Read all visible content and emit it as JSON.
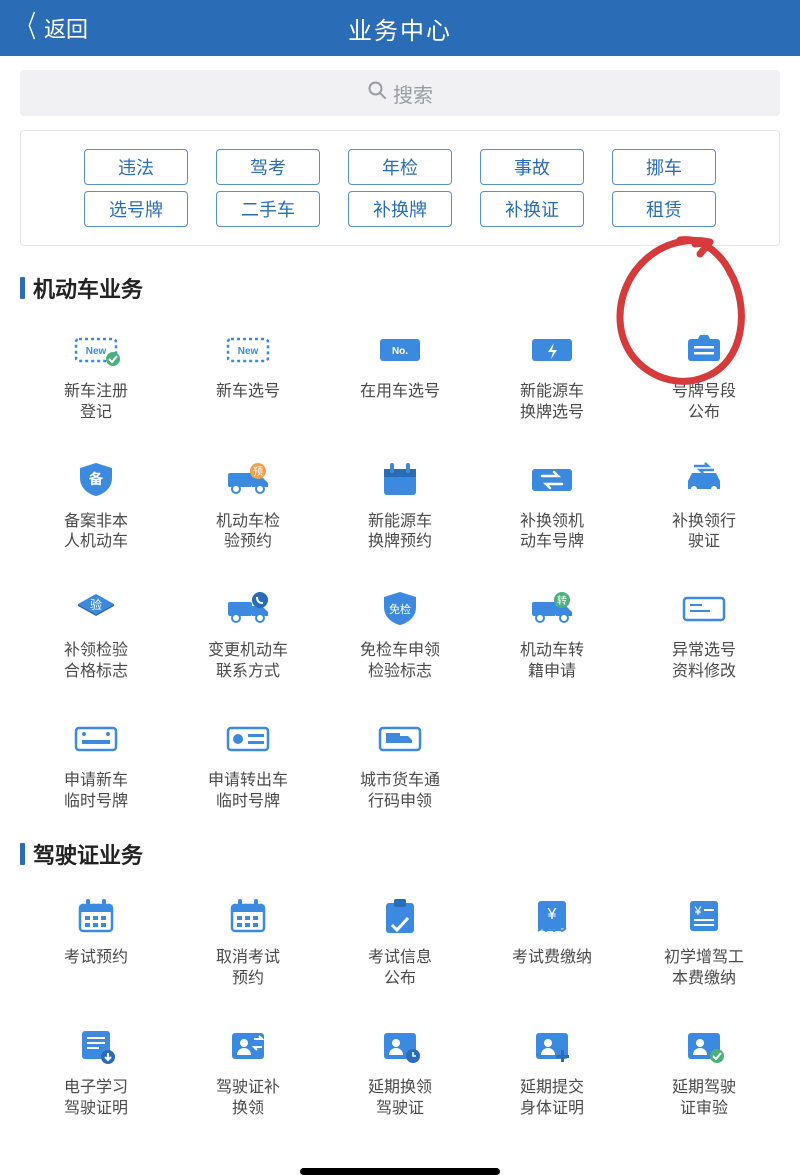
{
  "header": {
    "back_label": "返回",
    "title": "业务中心"
  },
  "search": {
    "placeholder": "搜索"
  },
  "tags_row1": [
    {
      "label": "违法"
    },
    {
      "label": "驾考"
    },
    {
      "label": "年检"
    },
    {
      "label": "事故"
    },
    {
      "label": "挪车"
    }
  ],
  "tags_row2": [
    {
      "label": "选号牌"
    },
    {
      "label": "二手车"
    },
    {
      "label": "补换牌"
    },
    {
      "label": "补换证"
    },
    {
      "label": "租赁"
    }
  ],
  "section1": {
    "title": "机动车业务",
    "items": [
      {
        "label": "新车注册\n登记",
        "icon": "plate-new-check"
      },
      {
        "label": "新车选号",
        "icon": "plate-new"
      },
      {
        "label": "在用车选号",
        "icon": "plate-no"
      },
      {
        "label": "新能源车\n换牌选号",
        "icon": "plate-energy"
      },
      {
        "label": "号牌号段\n公布",
        "icon": "plate-publish"
      },
      {
        "label": "备案非本\n人机动车",
        "icon": "shield-bei"
      },
      {
        "label": "机动车检\n验预约",
        "icon": "truck-yu"
      },
      {
        "label": "新能源车\n换牌预约",
        "icon": "calendar-blank"
      },
      {
        "label": "补换领机\n动车号牌",
        "icon": "plate-swap"
      },
      {
        "label": "补换领行\n驶证",
        "icon": "car-swap"
      },
      {
        "label": "补领检验\n合格标志",
        "icon": "shield-yan"
      },
      {
        "label": "变更机动车\n联系方式",
        "icon": "truck-phone"
      },
      {
        "label": "免检车申领\n检验标志",
        "icon": "shield-mianjian"
      },
      {
        "label": "机动车转\n籍申请",
        "icon": "truck-zhuan"
      },
      {
        "label": "异常选号\n资料修改",
        "icon": "plate-outline"
      },
      {
        "label": "申请新车\n临时号牌",
        "icon": "plate-dots"
      },
      {
        "label": "申请转出车\n临时号牌",
        "icon": "plate-radio"
      },
      {
        "label": "城市货车通\n行码申领",
        "icon": "plate-truck"
      }
    ]
  },
  "section2": {
    "title": "驾驶证业务",
    "items": [
      {
        "label": "考试预约",
        "icon": "calendar-grid"
      },
      {
        "label": "取消考试\n预约",
        "icon": "calendar-grid"
      },
      {
        "label": "考试信息\n公布",
        "icon": "clipboard"
      },
      {
        "label": "考试费缴纳",
        "icon": "bill"
      },
      {
        "label": "初学增驾工\n本费缴纳",
        "icon": "bill-list"
      },
      {
        "label": "电子学习\n驾驶证明",
        "icon": "doc-down"
      },
      {
        "label": "驾驶证补\n换领",
        "icon": "person-swap"
      },
      {
        "label": "延期换领\n驾驶证",
        "icon": "person-clock"
      },
      {
        "label": "延期提交\n身体证明",
        "icon": "person-plus"
      },
      {
        "label": "延期驾驶\n证审验",
        "icon": "person-check"
      }
    ]
  }
}
